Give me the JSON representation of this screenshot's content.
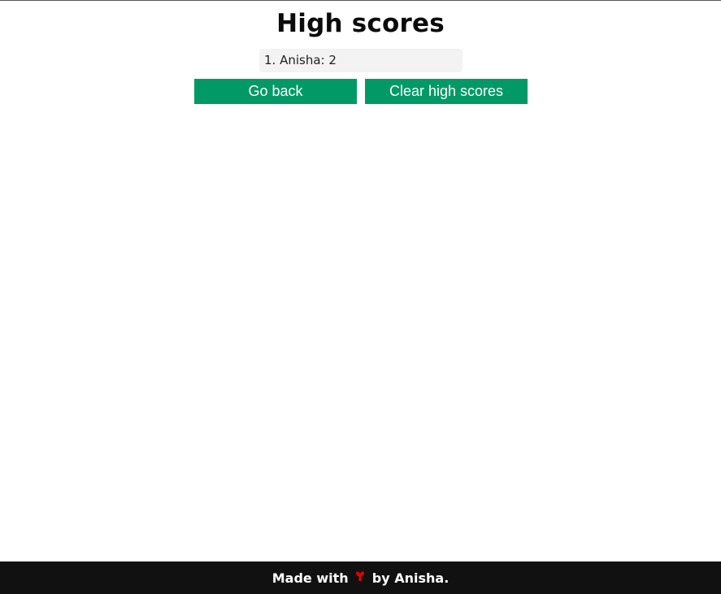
{
  "header": {
    "title": "High scores"
  },
  "scores": [
    {
      "text": "1. Anisha: 2"
    }
  ],
  "buttons": {
    "back_label": "Go back",
    "clear_label": "Clear high scores"
  },
  "footer": {
    "prefix": "Made with",
    "icon": "heart-icon",
    "suffix": "by Anisha."
  },
  "colors": {
    "button": "#019966",
    "footer_bg": "#111111",
    "heart": "#e00000"
  }
}
